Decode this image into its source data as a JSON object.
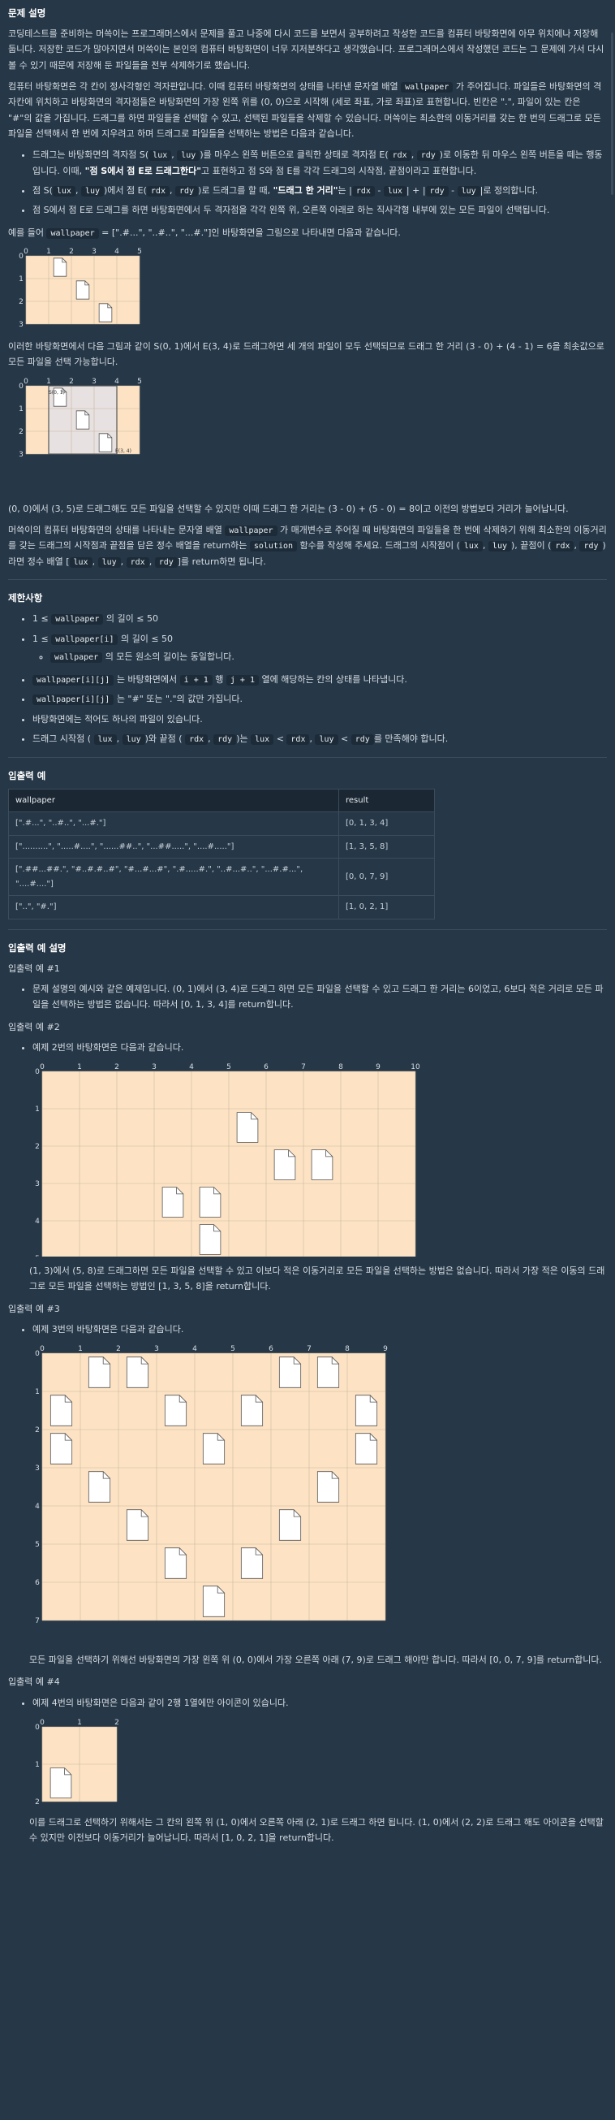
{
  "title": "문제 설명",
  "p1": "코딩테스트를 준비하는 머쓱이는 프로그래머스에서 문제를 풀고 나중에 다시 코드를 보면서 공부하려고 작성한 코드를 컴퓨터 바탕화면에 아무 위치에나 저장해 둡니다. 저장한 코드가 많아지면서 머쓱이는 본인의 컴퓨터 바탕화면이 너무 지저분하다고 생각했습니다. 프로그래머스에서 작성했던 코드는 그 문제에 가서 다시 볼 수 있기 때문에 저장해 둔 파일들을 전부 삭제하기로 했습니다.",
  "p2a": "컴퓨터 바탕화면은 각 칸이 정사각형인 격자판입니다. 이때 컴퓨터 바탕화면의 상태를 나타낸 문자열 배열",
  "p2code": "wallpaper",
  "p2b": "가 주어집니다. 파일들은 바탕화면의 격자칸에 위치하고 바탕화면의 격자점들은 바탕화면의 가장 왼쪽 위를 (0, 0)으로 시작해 (세로 좌표, 가로 좌표)로 표현합니다. 빈칸은 \".\", 파일이 있는 칸은 \"#\"의 값을 가집니다. 드래그를 하면 파일들을 선택할 수 있고, 선택된 파일들을 삭제할 수 있습니다. 머쓱이는 최소한의 이동거리를 갖는 한 번의 드래그로 모든 파일을 선택해서 한 번에 지우려고 하며 드래그로 파일들을 선택하는 방법은 다음과 같습니다.",
  "bullets": [
    [
      "드래그는 바탕화면의 격자점 S(",
      "lux",
      ", ",
      "luy",
      ")를 마우스 왼쪽 버튼으로 클릭한 상태로 격자점 E(",
      "rdx",
      ", ",
      "rdy",
      ")로 이동한 뒤 마우스 왼쪽 버튼을 떼는 행동입니다. 이때, ",
      "\"점 S에서 점 E로 드래그한다\"",
      "고 표현하고 점 S와 점 E를 각각 드래그의 시작점, 끝점이라고 표현합니다."
    ],
    [
      "점 S(",
      "lux",
      ", ",
      "luy",
      ")에서 점 E(",
      "rdx",
      ", ",
      "rdy",
      ")로 드래그를 할 때, ",
      "\"드래그 한 거리\"",
      "는 |",
      "rdx",
      " - ",
      "lux",
      "| + |",
      "rdy",
      " - ",
      "luy",
      "|로 정의합니다."
    ],
    [
      "점 S에서 점 E로 드래그를 하면 바탕화면에서 두 격자점을 각각 왼쪽 위, 오른쪽 아래로 하는 직사각형 내부에 있는 모든 파일이 선택됩니다."
    ]
  ],
  "example_intro_a": "예를 들어",
  "example_intro_b": "= [\".#...\", \"..#..\", \"...#.\"]인 바탕화면을 그림으로 나타내면 다음과 같습니다.",
  "p3": "이러한 바탕화면에서 다음 그림과 같이 S(0, 1)에서 E(3, 4)로 드래그하면 세 개의 파일이 모두 선택되므로 드래그 한 거리 (3 - 0) + (4 - 1) = 6을 최솟값으로 모든 파일을 선택 가능합니다.",
  "p4": "(0, 0)에서 (3, 5)로 드래그해도 모든 파일을 선택할 수 있지만 이때 드래그 한 거리는 (3 - 0) + (5 - 0) = 8이고 이전의 방법보다 거리가 늘어납니다.",
  "p5": [
    "머쓱이의 컴퓨터 바탕화면의 상태를 나타내는 문자열 배열",
    "wallpaper",
    "가 매개변수로 주어질 때 바탕화면의 파일들을 한 번에 삭제하기 위해 최소한의 이동거리를 갖는 드래그의 시작점과 끝점을 담은 정수 배열을 return하는",
    "solution",
    "함수를 작성해 주세요. 드래그의 시작점이 (",
    "lux",
    ",",
    "luy",
    "), 끝점이 (",
    "rdx",
    ",",
    "rdy",
    ")라면 정수 배열 [",
    "lux",
    ",",
    "luy",
    ",",
    "rdx",
    ",",
    "rdy",
    "]를 return하면 됩니다."
  ],
  "fig1": {
    "S": "S(0, 1)",
    "E": "E(3, 4)"
  },
  "limits_title": "제한사항",
  "limits": {
    "l1": [
      "1 ≤",
      "wallpaper",
      "의 길이 ≤ 50"
    ],
    "l2": [
      "1 ≤",
      "wallpaper[i]",
      "의 길이 ≤ 50"
    ],
    "l2sub": [
      "",
      "wallpaper",
      "의 모든 원소의 길이는 동일합니다."
    ],
    "l3": [
      "",
      "wallpaper[i][j]",
      "는 바탕화면에서",
      "i + 1",
      "행",
      "j + 1",
      "열에 해당하는 칸의 상태를 나타냅니다."
    ],
    "l4": [
      "",
      "wallpaper[i][j]",
      "는 \"#\" 또는 \".\"의 값만 가집니다."
    ],
    "l5": "바탕화면에는 적어도 하나의 파일이 있습니다.",
    "l6": [
      "드래그 시작점 (",
      "lux",
      ",",
      "luy",
      ")와 끝점 (",
      "rdx",
      ",",
      "rdy",
      ")는",
      "lux",
      "<",
      "rdx",
      ",",
      "luy",
      "<",
      "rdy",
      "를 만족해야 합니다."
    ]
  },
  "io_title": "입출력 예",
  "table": {
    "headers": [
      "wallpaper",
      "result"
    ],
    "rows": [
      [
        ".#...\", \"..#..\", \"...#.\"]",
        "[0, 1, 3, 4]"
      ],
      [
        "..........\", \".....#....\", \"......##..\", \"...##.....\", \"....#.....\"]",
        "[1, 3, 5, 8]"
      ],
      [
        ".##...##.\", \"#..#.#..#\", \"#...#...#\", \".#.....#.\", \"..#...#..\", \"...#.#...\", \"....#....\"]",
        "[0, 0, 7, 9]"
      ],
      [
        "..\", \"#.\"]",
        "[1, 0, 2, 1]"
      ]
    ]
  },
  "io_desc_title": "입출력 예 설명",
  "ex1_label": "입출력 예 #1",
  "ex1_text": "문제 설명의 예시와 같은 예제입니다. (0, 1)에서 (3, 4)로 드래그 하면 모든 파일을 선택할 수 있고 드래그 한 거리는 6이었고, 6보다 적은 거리로 모든 파일을 선택하는 방법은 없습니다. 따라서 [0, 1, 3, 4]를 return합니다.",
  "ex2_label": "입출력 예 #2",
  "ex2_intro": "예제 2번의 바탕화면은 다음과 같습니다.",
  "ex2_text": "(1, 3)에서 (5, 8)로 드래그하면 모든 파일을 선택할 수 있고 이보다 적은 이동거리로 모든 파일을 선택하는 방법은 없습니다. 따라서 가장 적은 이동의 드래그로 모든 파일을 선택하는 방법인 [1, 3, 5, 8]을 return합니다.",
  "ex3_label": "입출력 예 #3",
  "ex3_intro": "예제 3번의 바탕화면은 다음과 같습니다.",
  "ex3_text": "모든 파일을 선택하기 위해선 바탕화면의 가장 왼쪽 위 (0, 0)에서 가장 오른쪽 아래 (7, 9)로 드래그 해야만 합니다. 따라서 [0, 0, 7, 9]를 return합니다.",
  "ex4_label": "입출력 예 #4",
  "ex4_intro": "예제 4번의 바탕화면은 다음과 같이 2행 1열에만 아이콘이 있습니다.",
  "ex4_text": "이를 드래그로 선택하기 위해서는 그 칸의 왼쪽 위 (1, 0)에서 오른쪽 아래 (2, 1)로 드래그 하면 됩니다. (1, 0)에서 (2, 2)로 드래그 해도 아이콘을 선택할 수 있지만 이전보다 이동거리가 늘어납니다. 따라서 [1, 0, 2, 1]을 return합니다.",
  "grids": {
    "g1": [
      ".#...",
      "..#..",
      "...#."
    ],
    "g2": [
      "..........",
      ".....#....",
      "......##..",
      "...##.....",
      "....#....."
    ],
    "g3": [
      ".##...##.",
      "#..#.#..#",
      "#...#...#",
      ".#.....#.",
      "..#...#..",
      "...#.#...",
      "....#...."
    ],
    "g4": [
      "..",
      "#."
    ]
  },
  "colors": {
    "bg": "#263747",
    "grid": "#fde3c4",
    "line": "#333333",
    "select": "#e7e1e1"
  }
}
